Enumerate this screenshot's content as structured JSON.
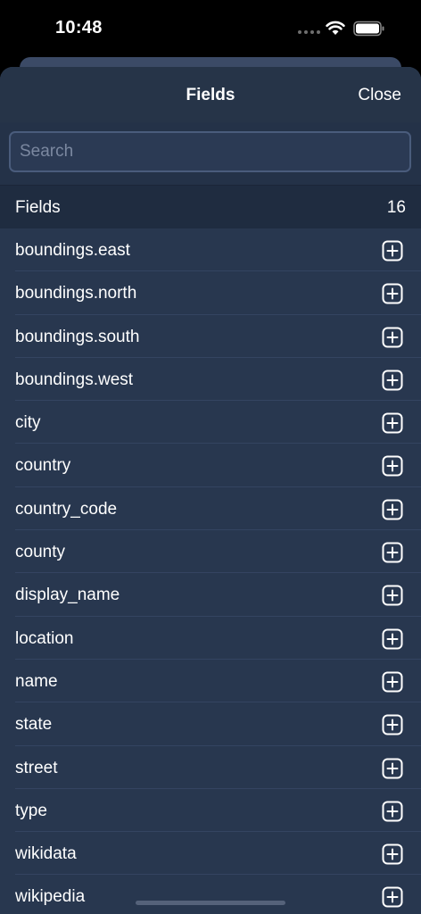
{
  "status_bar": {
    "time": "10:48"
  },
  "sheet": {
    "title": "Fields",
    "close_label": "Close",
    "search": {
      "placeholder": "Search",
      "value": ""
    },
    "section": {
      "label": "Fields",
      "count": "16"
    },
    "items": [
      {
        "label": "boundings.east"
      },
      {
        "label": "boundings.north"
      },
      {
        "label": "boundings.south"
      },
      {
        "label": "boundings.west"
      },
      {
        "label": "city"
      },
      {
        "label": "country"
      },
      {
        "label": "country_code"
      },
      {
        "label": "county"
      },
      {
        "label": "display_name"
      },
      {
        "label": "location"
      },
      {
        "label": "name"
      },
      {
        "label": "state"
      },
      {
        "label": "street"
      },
      {
        "label": "type"
      },
      {
        "label": "wikidata"
      },
      {
        "label": "wikipedia"
      }
    ]
  }
}
